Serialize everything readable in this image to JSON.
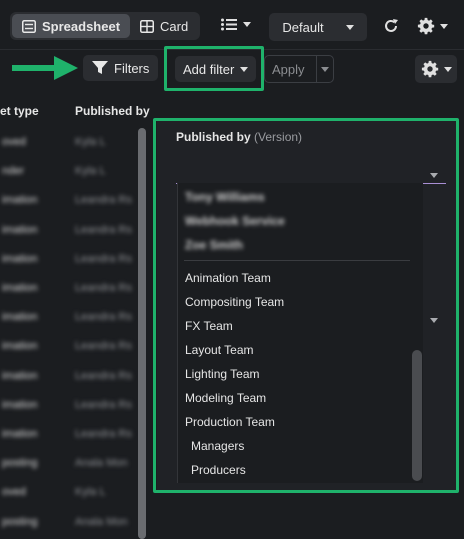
{
  "toolbar": {
    "view_spreadsheet": "Spreadsheet",
    "view_card": "Card",
    "preset": "Default"
  },
  "filterbar": {
    "filters_label": "Filters",
    "add_filter_label": "Add filter",
    "apply_label": "Apply"
  },
  "table": {
    "columns": [
      "et type",
      "Published by"
    ],
    "rows": [
      {
        "type": "oved",
        "by": "Kyla L"
      },
      {
        "type": "nder",
        "by": "Kyla L"
      },
      {
        "type": "imation",
        "by": "Leandra Rs"
      },
      {
        "type": "imation",
        "by": "Leandra Rs"
      },
      {
        "type": "imation",
        "by": "Leandra Rs"
      },
      {
        "type": "imation",
        "by": "Leandra Rs"
      },
      {
        "type": "imation",
        "by": "Leandra Rs"
      },
      {
        "type": "imation",
        "by": "Leandra Rs"
      },
      {
        "type": "imation",
        "by": "Leandra Rs"
      },
      {
        "type": "imation",
        "by": "Leandra Rs"
      },
      {
        "type": "imation",
        "by": "Leandra Rs"
      },
      {
        "type": "posting",
        "by": "Anala Mon"
      },
      {
        "type": "oved",
        "by": "Kyla L"
      },
      {
        "type": "posting",
        "by": "Anala Mon"
      }
    ]
  },
  "panel": {
    "title": "Published by",
    "title_suffix": "(Version)",
    "blurred_options": [
      "Tony Williams",
      "Webhook Service",
      "Zoe Smith"
    ],
    "options": [
      "Animation Team",
      "Compositing Team",
      "FX Team",
      "Layout Team",
      "Lighting Team",
      "Modeling Team",
      "Production Team",
      "Managers",
      "Producers"
    ]
  },
  "colors": {
    "highlight": "#1fb26b",
    "select_underline": "#a98fd4"
  }
}
